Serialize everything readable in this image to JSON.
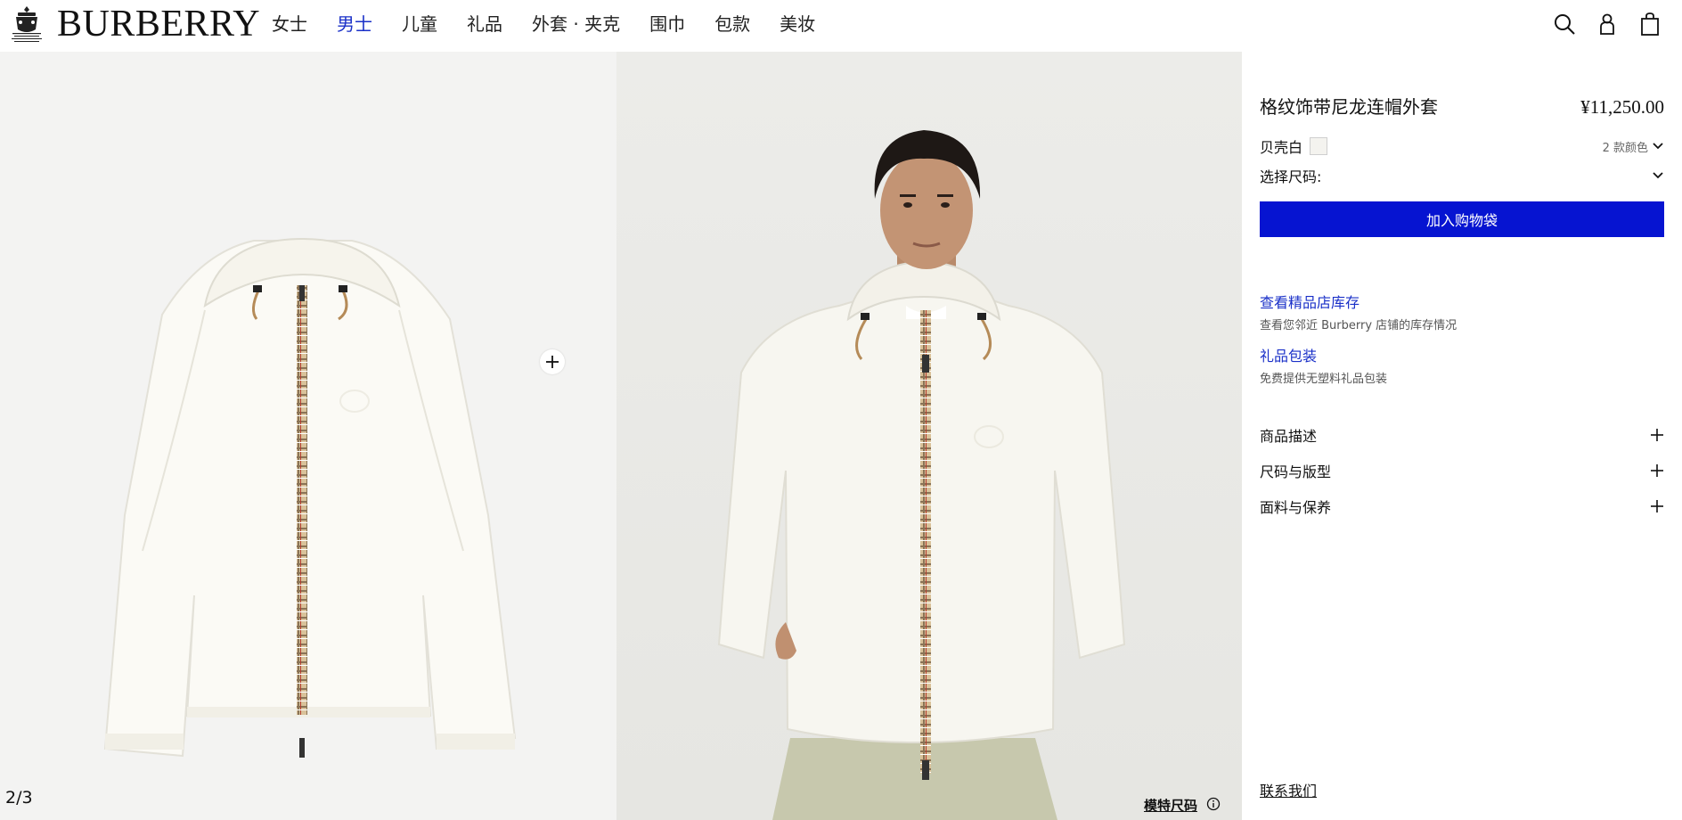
{
  "header": {
    "logo_text": "BURBERRY",
    "nav": [
      {
        "label": "女士",
        "active": false
      },
      {
        "label": "男士",
        "active": true
      },
      {
        "label": "儿童",
        "active": false
      },
      {
        "label": "礼品",
        "active": false
      },
      {
        "label": "外套 · 夹克",
        "active": false
      },
      {
        "label": "围巾",
        "active": false
      },
      {
        "label": "包款",
        "active": false
      },
      {
        "label": "美妆",
        "active": false
      }
    ],
    "icons": [
      "search-icon",
      "account-icon",
      "shopping-bag-icon"
    ]
  },
  "gallery": {
    "pager": "2/3",
    "model_size_label": "模特尺码",
    "images": [
      "jacket-flat-lay",
      "model-wearing-jacket"
    ]
  },
  "product": {
    "title": "格纹饰带尼龙连帽外套",
    "price": "¥11,250.00",
    "color_name": "贝壳白",
    "color_count": "2 款颜色",
    "size_label": "选择尺码:",
    "add_to_bag": "加入购物袋",
    "services": [
      {
        "link": "查看精品店库存",
        "desc": "查看您邻近 Burberry 店铺的库存情况"
      },
      {
        "link": "礼品包装",
        "desc": "免费提供无塑料礼品包装"
      }
    ],
    "accordions": [
      "商品描述",
      "尺码与版型",
      "面料与保养"
    ],
    "contact": "联系我们"
  },
  "colors": {
    "accent": "#0614d1",
    "link": "#1a30c8",
    "swatch": "#f4f3ef"
  }
}
